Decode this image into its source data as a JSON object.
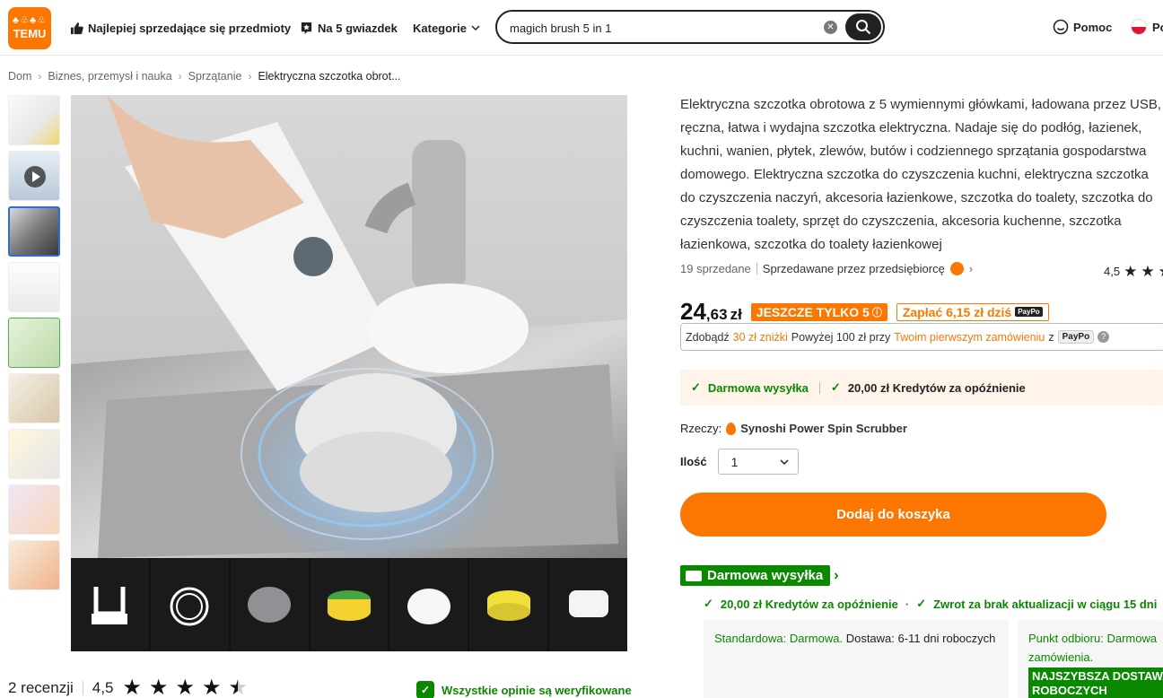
{
  "header": {
    "logo_symbols": "♣♧♣♧",
    "logo_text": "TEMU",
    "nav": {
      "bestsellers": "Najlepiej sprzedające się przedmioty",
      "five_stars": "Na 5 gwiazdek",
      "categories": "Kategorie"
    },
    "search": {
      "value": "magich brush 5 in 1",
      "placeholder": ""
    },
    "help": "Pomoc",
    "language": "Po"
  },
  "breadcrumb": [
    "Dom",
    "Biznes, przemysł i nauka",
    "Sprzątanie",
    "Elektryczna szczotka obrot..."
  ],
  "product": {
    "description": "Elektryczna szczotka obrotowa z 5 wymiennymi główkami, ładowana przez USB, ręczna, łatwa i wydajna szczotka elektryczna. Nadaje się do podłóg, łazienek, kuchni, wanien, płytek, zlewów, butów i codziennego sprzątania gospodarstwa domowego. Elektryczna szczotka do czyszczenia kuchni, elektryczna szczotka do czyszczenia naczyń, akcesoria łazienkowe, szczotka do toalety, szczotka do czyszczenia toalety, sprzęt do czyszczenia, akcesoria kuchenne, szczotka łazienkowa, szczotka do toalety łazienkowej",
    "sold": "19 sprzedane",
    "seller": "Sprzedawane przez przedsiębiorcę",
    "rating": "4,5",
    "price_main": "24",
    "price_cents": ",63",
    "currency": "zł",
    "stock_tag": "JESZCZE TYLKO 5",
    "pay_today": "Zapłać 6,15 zł dziś",
    "paypo_mini": "PayPo",
    "promo": {
      "prefix": "Zdobądź",
      "discount": "30 zł zniżki",
      "middle": "Powyżej 100 zł przy",
      "first_order": "Twoim pierwszym zamówieniu",
      "suffix": "z",
      "brand": "PayPo"
    },
    "shipping_box": {
      "free": "Darmowa wysyłka",
      "credit": "20,00 zł Kredytów za opóźnienie"
    },
    "item_label": "Rzeczy:",
    "item_value": "Synoshi Power Spin Scrubber",
    "qty_label": "Ilość",
    "qty_value": "1",
    "add_to_cart": "Dodaj do koszyka",
    "free_shipping_title": "Darmowa wysyłka",
    "shipping_points": {
      "credit": "20,00 zł Kredytów za opóźnienie",
      "refund": "Zwrot za brak aktualizacji w ciągu 15 dni"
    },
    "option_standard": {
      "label": "Standardowa: Darmowa.",
      "delivery": "Dostawa: 6-11 dni roboczych"
    },
    "option_pickup": {
      "label": "Punkt odbioru: Darmowa",
      "label2": "zamówienia.",
      "fastest": "NAJSZYBSZA DOSTAWA",
      "fastest2": "ROBOCZYCH"
    }
  },
  "reviews": {
    "count": "2 recenzji",
    "score": "4,5",
    "stars": 4.5,
    "verified": "Wszystkie opinie są weryfikowane"
  },
  "colors": {
    "brand_orange": "#fb7701",
    "green": "#0a8800",
    "dark": "#222222"
  },
  "icons": [
    "thumbs-up-icon",
    "star-badge-icon",
    "chevron-down-icon",
    "clear-icon",
    "search-icon",
    "smiley-icon",
    "play-icon",
    "check-icon",
    "truck-icon",
    "shield-check-icon",
    "question-icon"
  ]
}
